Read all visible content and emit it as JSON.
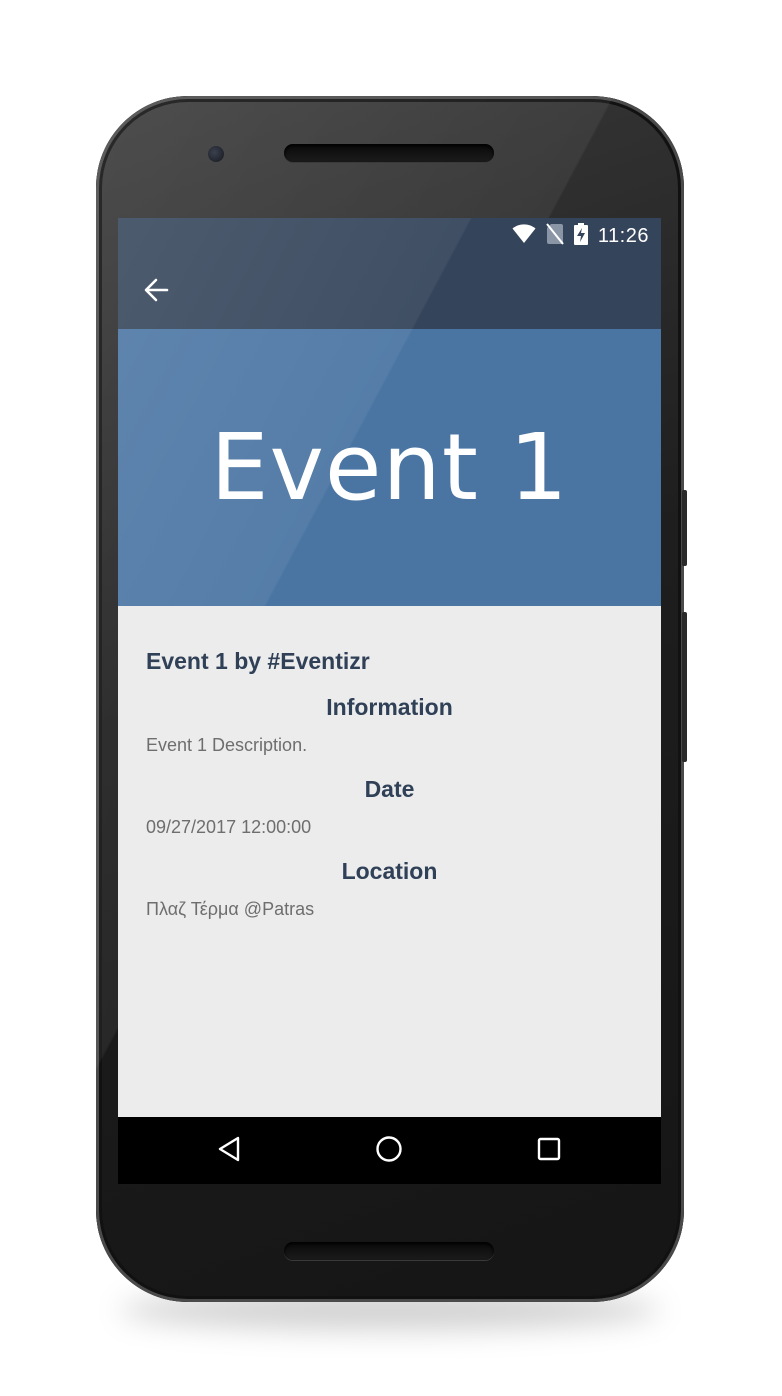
{
  "status_bar": {
    "time": "11:26",
    "icons": [
      "wifi-icon",
      "no-sim-icon",
      "battery-charging-icon"
    ]
  },
  "toolbar": {
    "back_icon": "arrow-left-icon"
  },
  "hero": {
    "title": "Event 1",
    "background_color": "#4a75a3"
  },
  "event": {
    "heading": "Event 1 by #Eventizr",
    "sections": [
      {
        "title": "Information",
        "text": "Event 1 Description."
      },
      {
        "title": "Date",
        "text": "09/27/2017 12:00:00"
      },
      {
        "title": "Location",
        "text": "Πλαζ Τέρμα @Patras"
      }
    ]
  },
  "nav_bar": {
    "buttons": [
      "back-triangle-icon",
      "home-circle-icon",
      "recents-square-icon"
    ]
  },
  "colors": {
    "toolbar": "#34445a",
    "accent": "#4a75a3",
    "heading_text": "#2f4057",
    "body_text": "#6e6e6e",
    "content_bg": "#ececec"
  }
}
